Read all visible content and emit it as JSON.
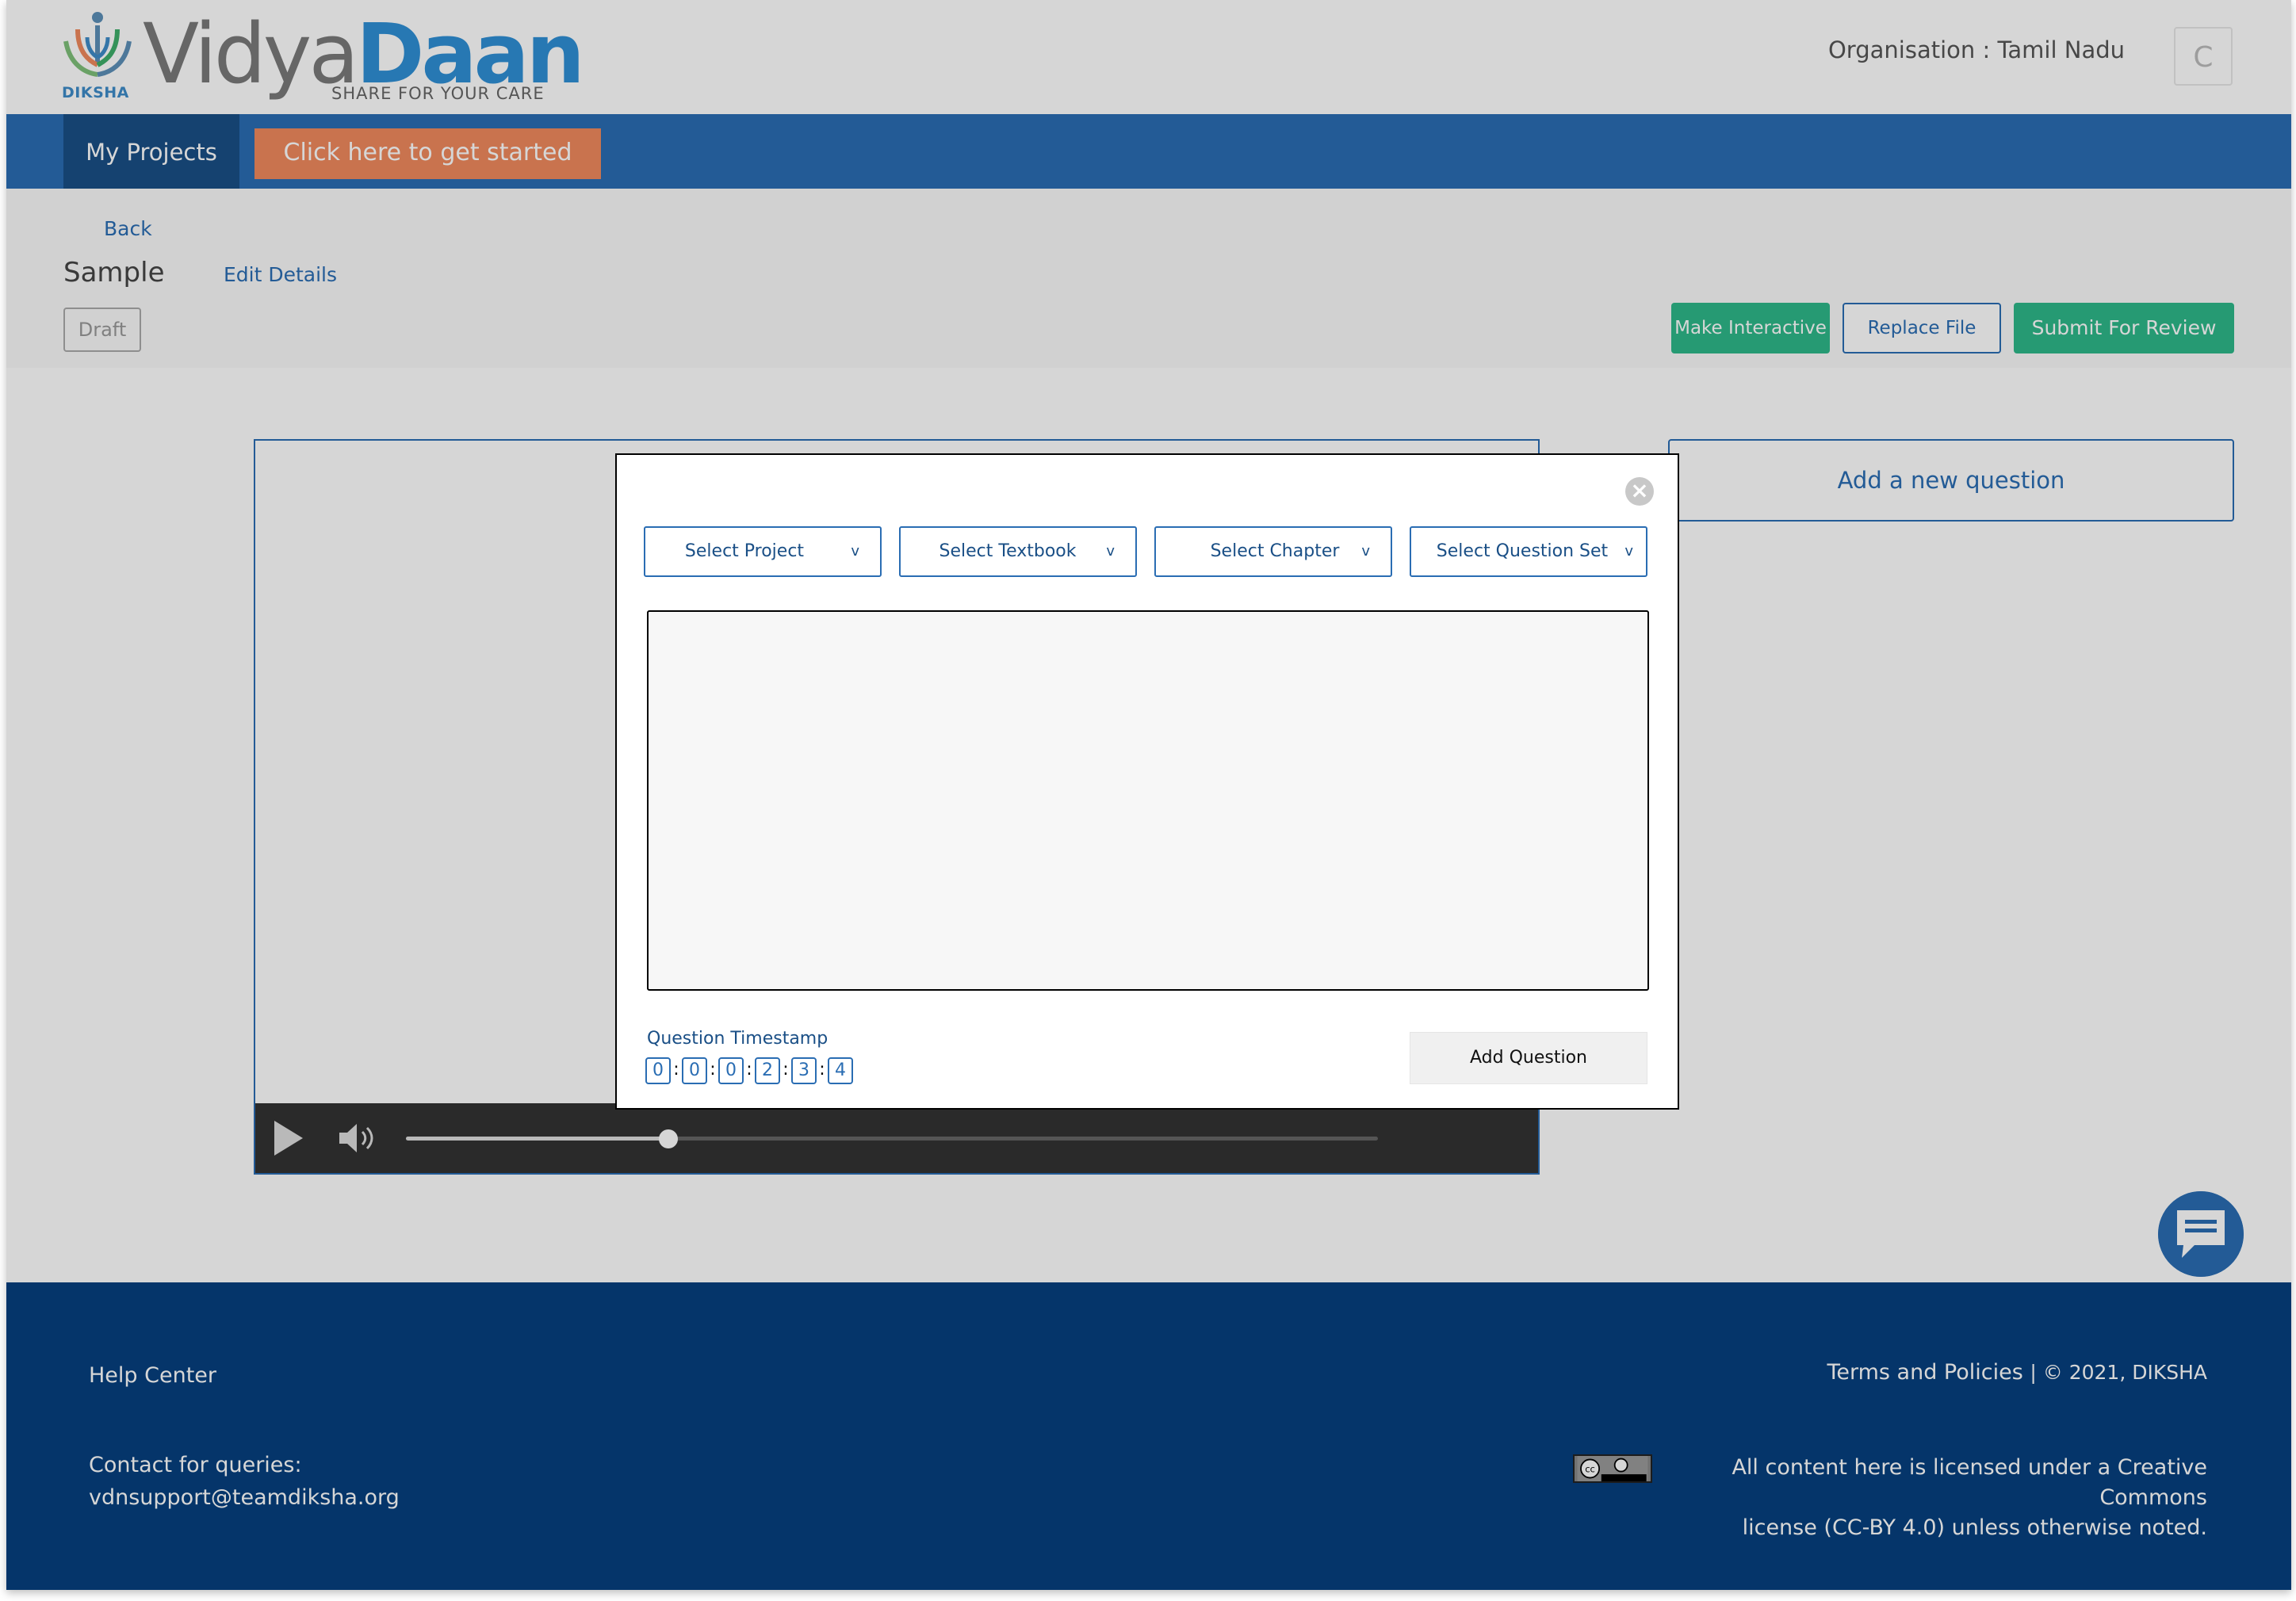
{
  "header": {
    "logo_mark": "diksha-logo-icon",
    "logo_subtitle": "DIKSHA",
    "logo_word_1": "Vidya",
    "logo_word_2": "Daan",
    "logo_tagline": "SHARE FOR YOUR CARE",
    "organisation": "Organisation : Tamil Nadu",
    "user_initial": "C"
  },
  "nav": {
    "my_projects": "My Projects",
    "cta": "Click here to get started"
  },
  "subheader": {
    "back": "Back",
    "title": "Sample",
    "edit_details": "Edit Details",
    "status": "Draft",
    "make_interactive": "Make Interactive",
    "replace_file": "Replace File",
    "submit_for_review": "Submit For Review"
  },
  "player": {
    "progress": 0.27,
    "play_icon": "play-icon",
    "volume_icon": "volume-icon"
  },
  "sidebar": {
    "add_new_question": "Add a new question"
  },
  "modal": {
    "close_icon": "close-icon",
    "select_project": "Select Project",
    "select_textbook": "Select Textbook",
    "select_chapter": "Select Chapter",
    "select_question_set": "Select Question Set",
    "chevron": "v",
    "timestamp_label": "Question Timestamp",
    "timestamp_digits": [
      "0",
      "0",
      "0",
      "2",
      "3",
      "4"
    ],
    "timestamp_separator": ":",
    "add_question": "Add Question"
  },
  "footer": {
    "help_center": "Help Center",
    "contact_label": "Contact for queries:",
    "contact_email": "vdnsupport@teamdiksha.org",
    "terms": "Terms and Policies",
    "copyright": "| © 2021, DIKSHA",
    "license_line_1": "All content here is licensed under a Creative Commons",
    "license_line_2": "license (CC-BY 4.0) unless otherwise noted.",
    "cc_icon": "cc-by-license-icon"
  },
  "colors": {
    "primary": "#2a6db3",
    "nav_active": "#1a4f86",
    "cta": "#f08a5d",
    "green": "#2eb88a",
    "footer": "#06407f"
  }
}
